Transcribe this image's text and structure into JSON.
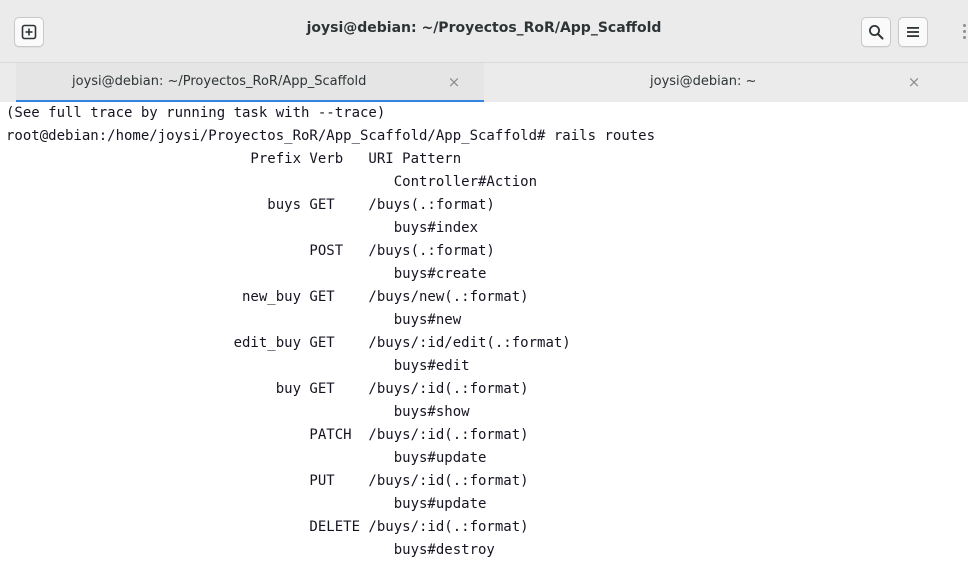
{
  "window": {
    "title": "joysi@debian: ~/Proyectos_RoR/App_Scaffold",
    "icons": [
      "new-tab-icon",
      "search-icon",
      "hamburger-menu-icon"
    ]
  },
  "tabs": [
    {
      "label": "joysi@debian: ~/Proyectos_RoR/App_Scaffold",
      "active": true,
      "close": "×"
    },
    {
      "label": "joysi@debian: ~",
      "active": false,
      "close": "×"
    }
  ],
  "colors": {
    "accent": "#3584e4",
    "headerbar_bg": "#ebebeb",
    "terminal_bg": "#ffffff",
    "terminal_fg": "#171421"
  },
  "terminal": {
    "lines": [
      "(See full trace by running task with --trace)",
      "root@debian:/home/joysi/Proyectos_RoR/App_Scaffold/App_Scaffold# rails routes",
      "                             Prefix Verb   URI Pattern",
      "                                              Controller#Action",
      "                               buys GET    /buys(.:format)",
      "                                              buys#index",
      "                                    POST   /buys(.:format)",
      "                                              buys#create",
      "                            new_buy GET    /buys/new(.:format)",
      "                                              buys#new",
      "                           edit_buy GET    /buys/:id/edit(.:format)",
      "                                              buys#edit",
      "                                buy GET    /buys/:id(.:format)",
      "                                              buys#show",
      "                                    PATCH  /buys/:id(.:format)",
      "                                              buys#update",
      "                                    PUT    /buys/:id(.:format)",
      "                                              buys#update",
      "                                    DELETE /buys/:id(.:format)",
      "                                              buys#destroy"
    ]
  }
}
